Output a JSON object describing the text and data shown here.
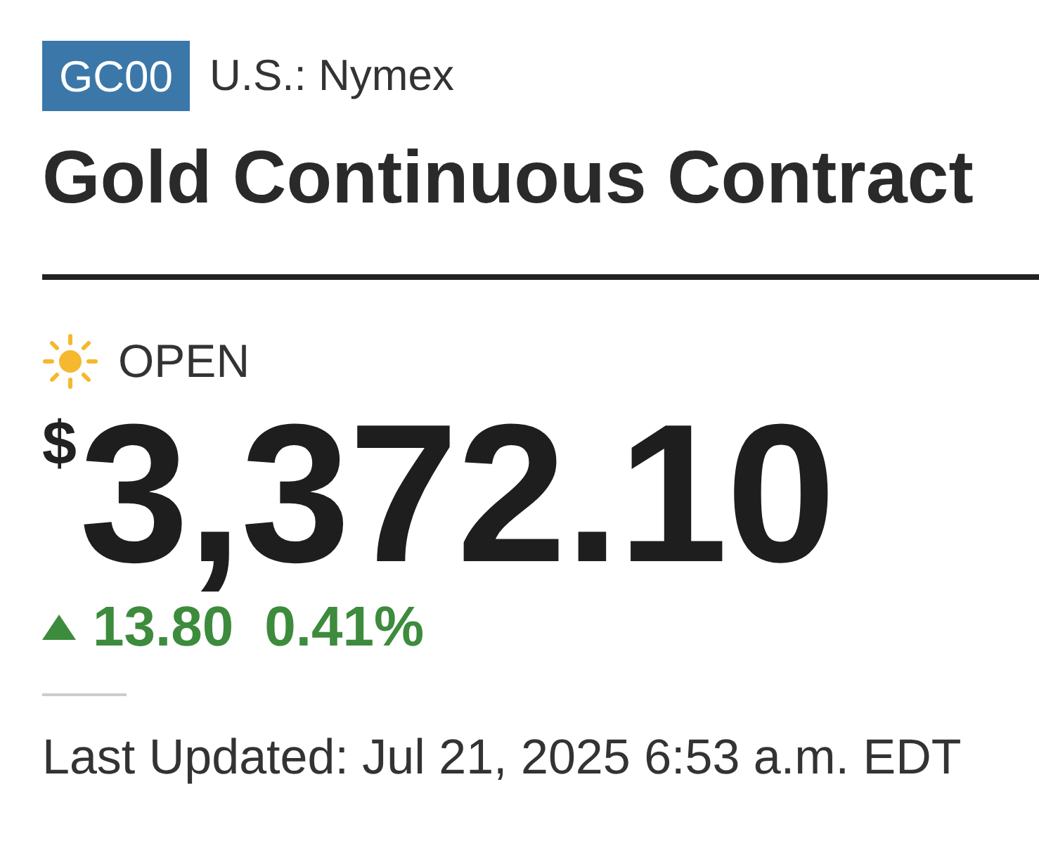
{
  "ticker": {
    "symbol": "GC00",
    "exchange": "U.S.: Nymex"
  },
  "title": "Gold Continuous Contract",
  "market": {
    "open": true,
    "label": "OPEN"
  },
  "quote": {
    "currency": "$",
    "price": "3,372.10",
    "up": true,
    "change": "13.80",
    "change_percent": "0.41%"
  },
  "last_updated": "Last Updated: Jul 21, 2025 6:53 a.m. EDT"
}
